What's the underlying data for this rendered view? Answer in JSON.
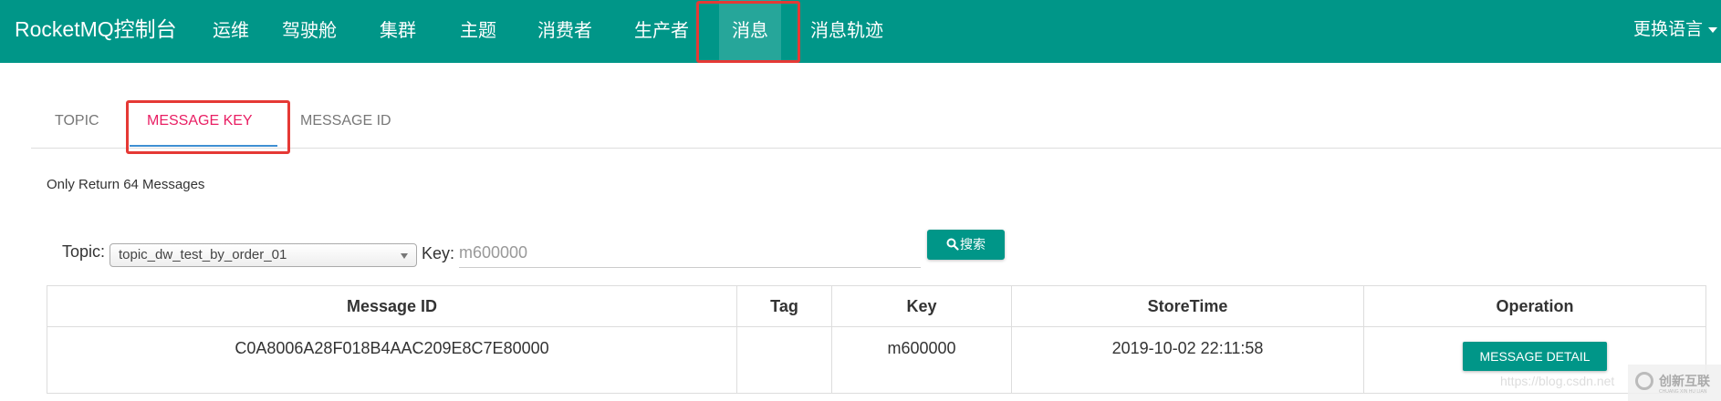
{
  "navbar": {
    "brand": "RocketMQ控制台",
    "items": [
      {
        "label": "运维"
      },
      {
        "label": "驾驶舱"
      },
      {
        "label": "集群"
      },
      {
        "label": "主题"
      },
      {
        "label": "消费者"
      },
      {
        "label": "生产者"
      },
      {
        "label": "消息",
        "active": true
      },
      {
        "label": "消息轨迹"
      }
    ],
    "language": "更换语言"
  },
  "tabs": [
    {
      "label": "TOPIC"
    },
    {
      "label": "MESSAGE KEY",
      "active": true
    },
    {
      "label": "MESSAGE ID"
    }
  ],
  "info": "Only Return 64 Messages",
  "search": {
    "topic_label": "Topic:",
    "topic_value": "topic_dw_test_by_order_01",
    "key_label": "Key:",
    "key_value": "m600000",
    "button_label": "搜索"
  },
  "table": {
    "headers": [
      "Message ID",
      "Tag",
      "Key",
      "StoreTime",
      "Operation"
    ],
    "rows": [
      {
        "message_id": "C0A8006A28F018B4AAC209E8C7E80000",
        "tag": "",
        "key": "m600000",
        "store_time": "2019-10-02 22:11:58",
        "operation": "MESSAGE DETAIL"
      }
    ]
  },
  "watermark": {
    "url": "https://blog.csdn.net",
    "logo_text": "创新互联",
    "logo_sub": "CHUANG XIN HU LIAN"
  },
  "colors": {
    "primary": "#009688",
    "active_nav": "#26a69a",
    "active_tab": "#e91e63",
    "highlight": "#e53935"
  }
}
